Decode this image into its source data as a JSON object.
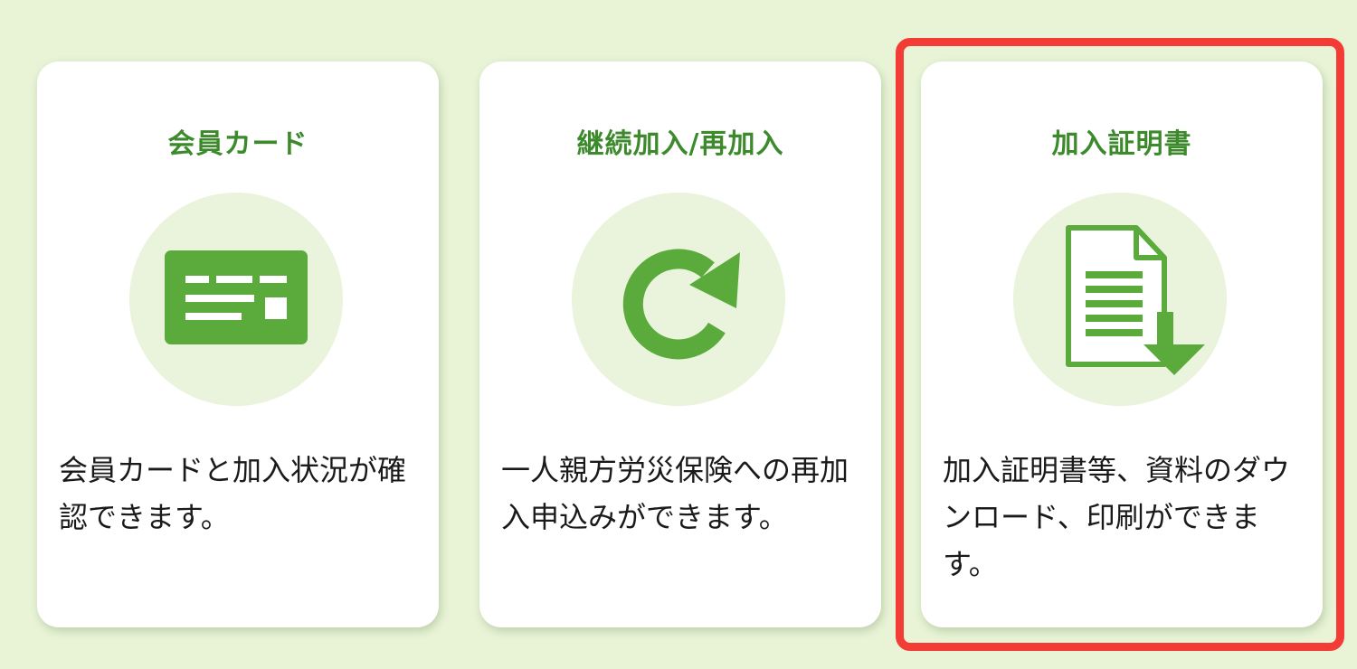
{
  "colors": {
    "page_background": "#e9f4d7",
    "card_background": "#ffffff",
    "title_green": "#3c8a2c",
    "icon_green": "#5aab3c",
    "icon_circle": "#eaf3db",
    "highlight_red": "#f43c36"
  },
  "cards": [
    {
      "title": "会員カード",
      "description": "会員カードと加入状況が確認できます。",
      "icon": "member-card-icon"
    },
    {
      "title": "継続加入/再加入",
      "description": "一人親方労災保険への再加入申込みができます。",
      "icon": "refresh-icon"
    },
    {
      "title": "加入証明書",
      "description": "加入証明書等、資料のダウンロード、印刷ができます。",
      "icon": "document-download-icon",
      "highlighted": true
    }
  ]
}
